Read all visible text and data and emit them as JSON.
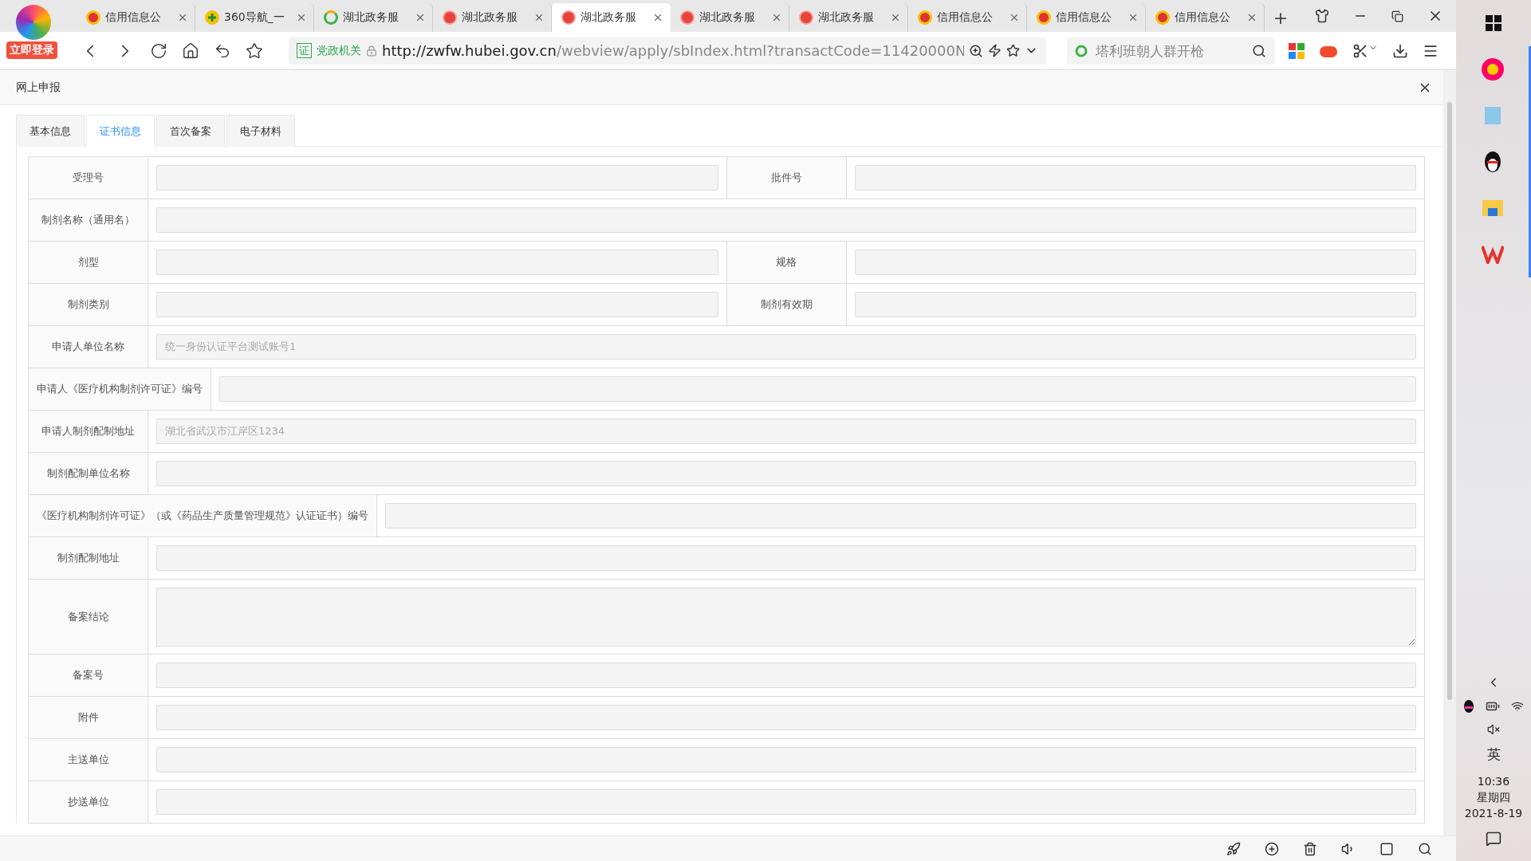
{
  "browser": {
    "login_badge": "立即登录",
    "tabs": [
      {
        "title": "信用信息公",
        "kind": "emblem",
        "selected": false
      },
      {
        "title": "360导航_一",
        "kind": "plus",
        "selected": false
      },
      {
        "title": "湖北政务服",
        "kind": "ring",
        "selected": false
      },
      {
        "title": "湖北政务服",
        "kind": "seal",
        "selected": false
      },
      {
        "title": "湖北政务服",
        "kind": "seal",
        "selected": true
      },
      {
        "title": "湖北政务服",
        "kind": "seal",
        "selected": false
      },
      {
        "title": "湖北政务服",
        "kind": "seal",
        "selected": false
      },
      {
        "title": "信用信息公",
        "kind": "emblem",
        "selected": false
      },
      {
        "title": "信用信息公",
        "kind": "emblem",
        "selected": false
      },
      {
        "title": "信用信息公",
        "kind": "emblem",
        "selected": false
      }
    ],
    "new_tab": "+",
    "address": {
      "badge": "证",
      "badge_label": "党政机关",
      "host": "http://zwfw.hubei.gov.cn",
      "path": "/webview/apply/sbIndex.html?transactCode=11420000N"
    },
    "search": {
      "placeholder": "塔利班朝人群开枪"
    }
  },
  "dialog": {
    "title": "网上申报",
    "tabs": [
      {
        "label": "基本信息",
        "selected": false
      },
      {
        "label": "证书信息",
        "selected": true
      },
      {
        "label": "首次备案",
        "selected": false
      },
      {
        "label": "电子材料",
        "selected": false
      }
    ],
    "rows": [
      {
        "kind": "pair",
        "fields": [
          {
            "label": "受理号"
          },
          {
            "label": "批件号"
          }
        ]
      },
      {
        "kind": "single",
        "fields": [
          {
            "label": "制剂名称（通用名）"
          }
        ]
      },
      {
        "kind": "pair",
        "fields": [
          {
            "label": "剂型"
          },
          {
            "label": "规格"
          }
        ]
      },
      {
        "kind": "pair",
        "fields": [
          {
            "label": "制剂类别"
          },
          {
            "label": "制剂有效期"
          }
        ]
      },
      {
        "kind": "single",
        "fields": [
          {
            "label": "申请人单位名称",
            "value": "统一身份认证平台测试账号1"
          }
        ]
      },
      {
        "kind": "single",
        "fields": [
          {
            "label": "申请人《医疗机构制剂许可证》编号"
          }
        ]
      },
      {
        "kind": "single",
        "fields": [
          {
            "label": "申请人制剂配制地址",
            "value": "湖北省武汉市江岸区1234"
          }
        ]
      },
      {
        "kind": "single",
        "fields": [
          {
            "label": "制剂配制单位名称"
          }
        ]
      },
      {
        "kind": "single",
        "fields": [
          {
            "label": "《医疗机构制剂许可证》（或《药品生产质量管理规范》认证证书）编号"
          }
        ]
      },
      {
        "kind": "single",
        "fields": [
          {
            "label": "制剂配制地址"
          }
        ]
      },
      {
        "kind": "textarea",
        "fields": [
          {
            "label": "备案结论"
          }
        ]
      },
      {
        "kind": "single",
        "fields": [
          {
            "label": "备案号"
          }
        ]
      },
      {
        "kind": "single",
        "fields": [
          {
            "label": "附件"
          }
        ]
      },
      {
        "kind": "single",
        "fields": [
          {
            "label": "主送单位"
          }
        ]
      },
      {
        "kind": "single",
        "fields": [
          {
            "label": "抄送单位"
          }
        ]
      }
    ]
  },
  "taskbar": {
    "input_method": "英",
    "time": "10:36",
    "weekday": "星期四",
    "date": "2021-8-19"
  }
}
